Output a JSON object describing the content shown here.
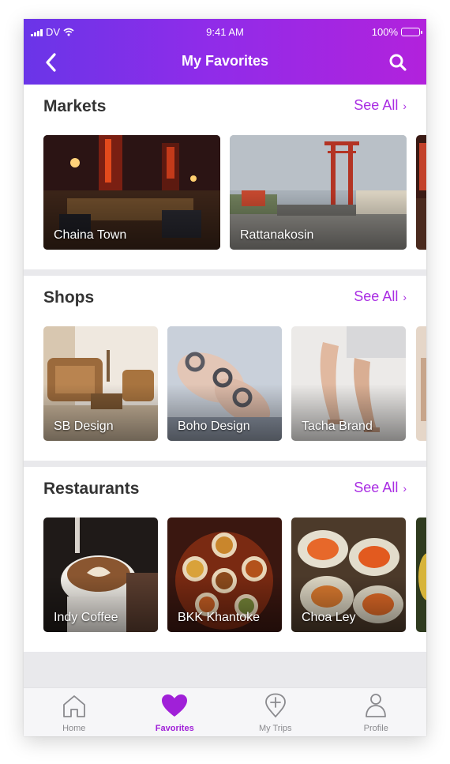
{
  "status": {
    "carrier": "DV",
    "time": "9:41 AM",
    "battery": "100%"
  },
  "header": {
    "title": "My Favorites"
  },
  "sections": [
    {
      "title": "Markets",
      "see_all": "See All",
      "items": [
        {
          "label": "Chaina Town"
        },
        {
          "label": "Rattanakosin"
        }
      ]
    },
    {
      "title": "Shops",
      "see_all": "See All",
      "items": [
        {
          "label": "SB Design"
        },
        {
          "label": "Boho Design"
        },
        {
          "label": "Tacha Brand"
        }
      ]
    },
    {
      "title": "Restaurants",
      "see_all": "See All",
      "items": [
        {
          "label": "Indy Coffee"
        },
        {
          "label": "BKK Khantoke"
        },
        {
          "label": "Choa Ley"
        }
      ]
    }
  ],
  "tabs": [
    {
      "label": "Home",
      "icon": "home-icon"
    },
    {
      "label": "Favorites",
      "icon": "heart-icon",
      "active": true
    },
    {
      "label": "My Trips",
      "icon": "map-pin-plus-icon"
    },
    {
      "label": "Profile",
      "icon": "person-icon"
    }
  ],
  "colors": {
    "accent": "#a92ce3",
    "header_start": "#6a35e8",
    "header_end": "#b222dc"
  }
}
